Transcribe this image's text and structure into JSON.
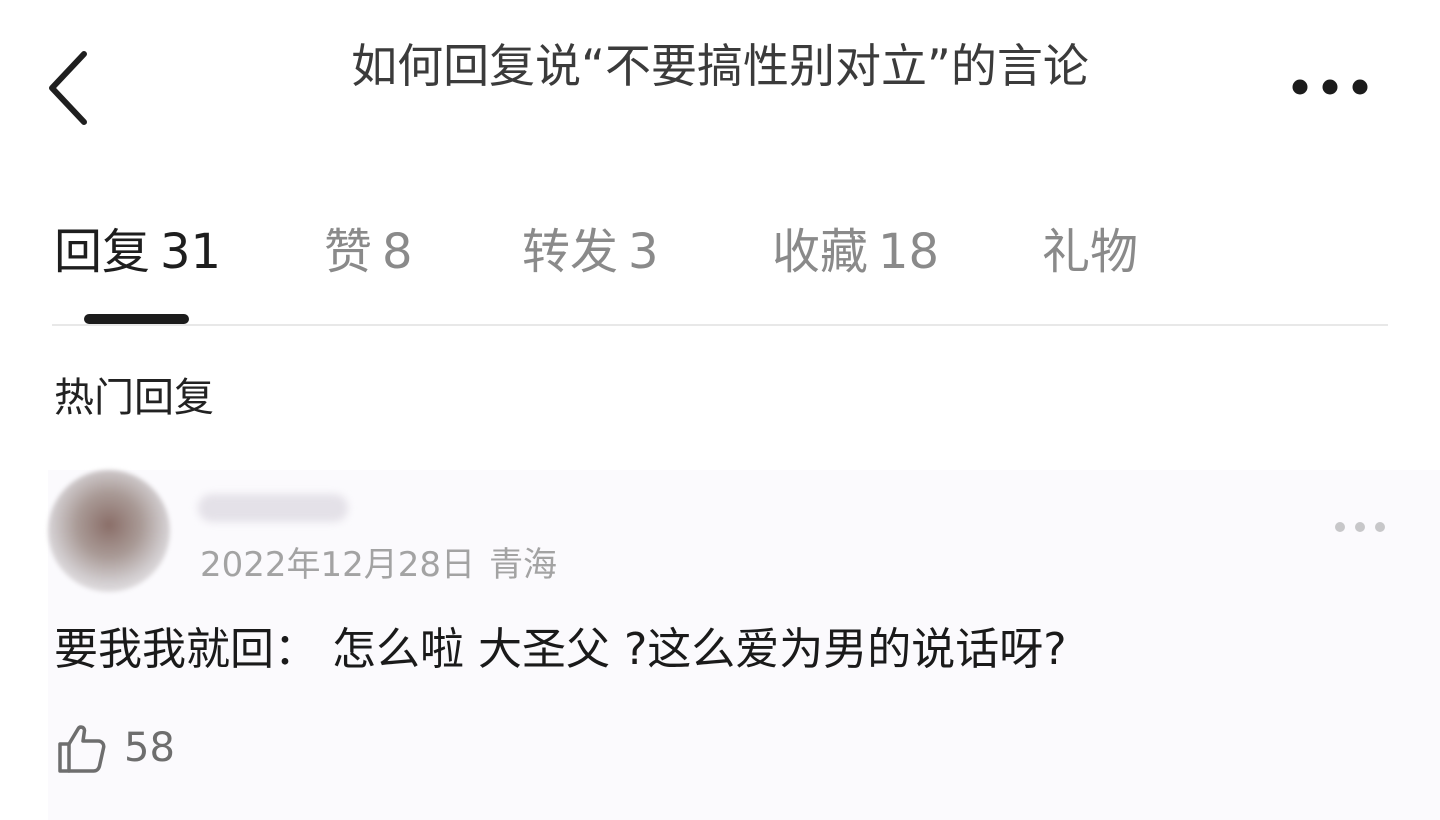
{
  "header": {
    "title": "如何回复说“不要搞性别对立”的言论",
    "back_icon": "chevron-left-icon",
    "more_icon": "more-horizontal-icon"
  },
  "tabs": [
    {
      "label": "回复",
      "count": "31",
      "active": true
    },
    {
      "label": "赞",
      "count": "8",
      "active": false
    },
    {
      "label": "转发",
      "count": "3",
      "active": false
    },
    {
      "label": "收藏",
      "count": "18",
      "active": false
    },
    {
      "label": "礼物",
      "count": "",
      "active": false
    }
  ],
  "section": {
    "title": "热门回复"
  },
  "comment": {
    "date": "2022年12月28日",
    "location": "青海",
    "text": "要我我就回： 怎么啦 大圣父 ?这么爱为男的说话呀?",
    "likes": "58",
    "like_icon": "thumbs-up-icon",
    "more_icon": "more-horizontal-icon"
  },
  "colors": {
    "active_tab": "#1e1e1e",
    "inactive_tab": "#8a8a8a",
    "meta_text": "#a3a3a3",
    "comment_bg": "#fbfafd"
  }
}
